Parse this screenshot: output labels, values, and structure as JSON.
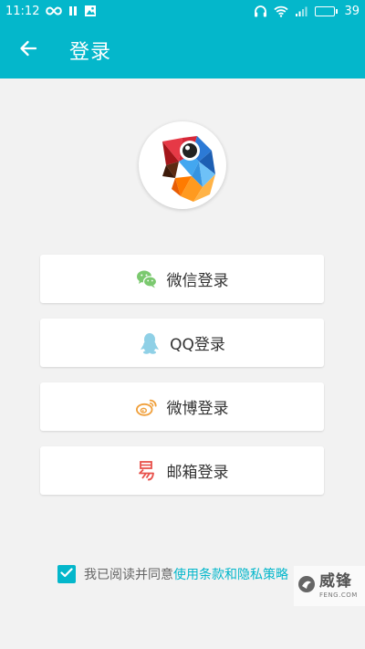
{
  "status_bar": {
    "time": "11:12",
    "battery_level": "39",
    "battery_fraction": 0.39,
    "icons": [
      "infinity-icon",
      "pause-icon",
      "image-notification-icon",
      "headphones-icon",
      "wifi-icon",
      "signal-icon",
      "battery-icon"
    ]
  },
  "app_bar": {
    "title": "登录",
    "back_icon": "arrow-left-icon",
    "background_color": "#04b7cb"
  },
  "logo": {
    "icon": "parrot-logo-icon"
  },
  "login_options": {
    "wechat": {
      "label": "微信登录",
      "icon": "wechat-icon",
      "color": "#7bc96f"
    },
    "qq": {
      "label": "QQ登录",
      "icon": "qq-penguin-icon",
      "color": "#8fd0e6"
    },
    "weibo": {
      "label": "微博登录",
      "icon": "weibo-icon",
      "color": "#f0a03c"
    },
    "email": {
      "label": "邮箱登录",
      "icon": "email-yi-icon",
      "color": "#e8514b"
    }
  },
  "agreement": {
    "checked": true,
    "prefix": "我已阅读并同意",
    "link": "使用条款和隐私策略"
  },
  "watermark": {
    "main": "威锋",
    "sub": "FENG.COM"
  },
  "accent_color": "#04b7cb"
}
